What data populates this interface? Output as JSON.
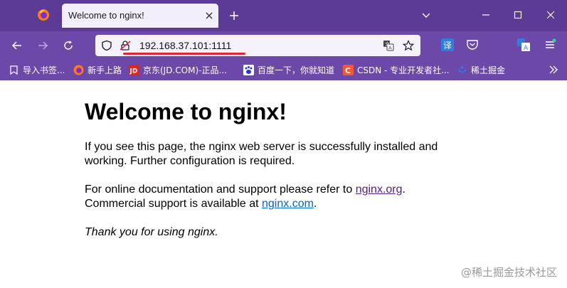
{
  "browser": {
    "tab": {
      "title": "Welcome to nginx!"
    },
    "address_bar": {
      "url": "192.168.37.101:1111"
    },
    "bookmarks": [
      {
        "label": "导入书签...",
        "icon": "import-bookmarks-icon"
      },
      {
        "label": "新手上路",
        "icon": "firefox-icon"
      },
      {
        "label": "京东(JD.COM)-正品...",
        "icon": "jd-icon"
      },
      {
        "label": "百度一下，你就知道",
        "icon": "baidu-paw-icon"
      },
      {
        "label": "CSDN - 专业开发者社...",
        "icon": "csdn-icon"
      },
      {
        "label": "稀土掘金",
        "icon": "juejin-icon"
      }
    ],
    "colors": {
      "titlebar": "#5b3b96",
      "toolbar": "#6c48a8",
      "url_underline": "#e0253a"
    }
  },
  "page": {
    "heading": "Welcome to nginx!",
    "para1": "If you see this page, the nginx web server is successfully installed and working. Further configuration is required.",
    "para2_prefix": "For online documentation and support please refer to ",
    "link_org": "nginx.org",
    "para2_mid": ".",
    "para2_line2": "Commercial support is available at ",
    "link_com": "nginx.com",
    "para2_end": ".",
    "thanks": "Thank you for using nginx."
  },
  "watermark": "@稀土掘金技术社区"
}
